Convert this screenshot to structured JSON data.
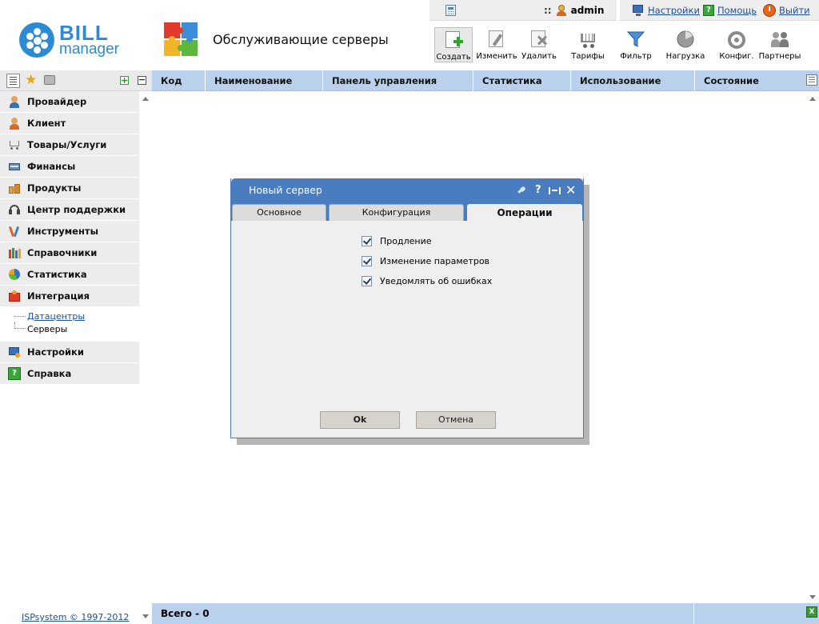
{
  "userbar": {
    "separator": "::",
    "username": "admin",
    "settings_label": "Настройки",
    "help_label": "Помощь",
    "logout_label": "Выйти"
  },
  "logo": {
    "line1": "BILL",
    "line2": "manager"
  },
  "page_title": "Обслуживающие серверы",
  "toolbar": [
    {
      "label": "Создать",
      "icon": "create-icon"
    },
    {
      "label": "Изменить",
      "icon": "edit-icon"
    },
    {
      "label": "Удалить",
      "icon": "delete-icon"
    },
    {
      "label": "Тарифы",
      "icon": "cart-icon"
    },
    {
      "label": "Фильтр",
      "icon": "filter-icon"
    },
    {
      "label": "Нагрузка",
      "icon": "load-icon"
    },
    {
      "label": "Конфиг.",
      "icon": "config-icon"
    },
    {
      "label": "Партнеры",
      "icon": "partners-icon"
    }
  ],
  "sidebar": {
    "items": [
      {
        "label": "Провайдер",
        "icon": "provider-icon"
      },
      {
        "label": "Клиент",
        "icon": "client-icon"
      },
      {
        "label": "Товары/Услуги",
        "icon": "cart-icon"
      },
      {
        "label": "Финансы",
        "icon": "finance-icon"
      },
      {
        "label": "Продукты",
        "icon": "products-icon"
      },
      {
        "label": "Центр поддержки",
        "icon": "headset-icon"
      },
      {
        "label": "Инструменты",
        "icon": "tools-icon"
      },
      {
        "label": "Справочники",
        "icon": "reference-icon"
      },
      {
        "label": "Статистика",
        "icon": "statistics-icon"
      },
      {
        "label": "Интеграция",
        "icon": "integration-icon"
      }
    ],
    "sub_items": [
      {
        "label": "Датацентры"
      },
      {
        "label": "Серверы"
      }
    ],
    "bottom_items": [
      {
        "label": "Настройки",
        "icon": "settings-icon"
      },
      {
        "label": "Справка",
        "icon": "help-icon"
      }
    ]
  },
  "copyright": "ISPsystem © 1997-2012",
  "table": {
    "columns": [
      "Код",
      "Наименование",
      "Панель управления",
      "Статистика",
      "Использование",
      "Состояние"
    ],
    "footer_total": "Всего - 0"
  },
  "dialog": {
    "title": "Новый сервер",
    "tabs": [
      "Основное",
      "Конфигурация",
      "Операции"
    ],
    "active_tab": "Операции",
    "checkboxes": [
      {
        "label": "Продление",
        "checked": true
      },
      {
        "label": "Изменение параметров",
        "checked": true
      },
      {
        "label": "Уведомлять об ошибках",
        "checked": true
      }
    ],
    "ok_label": "Ok",
    "cancel_label": "Отмена",
    "help_glyph": "?"
  },
  "colors": {
    "accent_blue": "#4a7cc0",
    "header_blue": "#b9d1ec",
    "logo_blue": "#2d8ad4"
  }
}
